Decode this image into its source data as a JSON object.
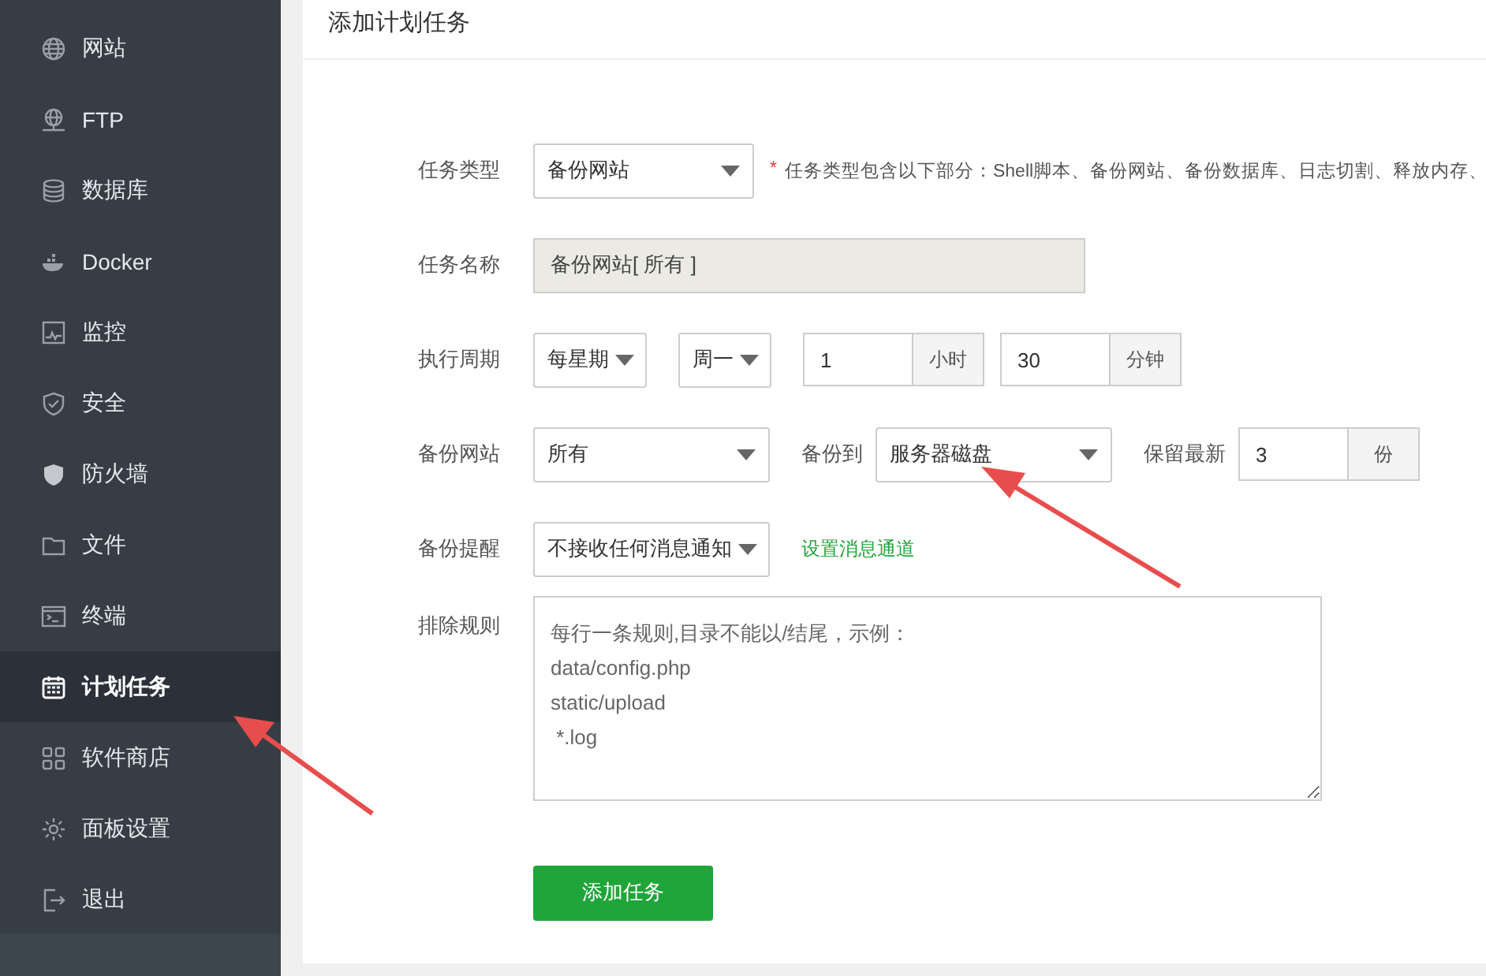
{
  "sidebar": {
    "items": [
      {
        "label": "网站",
        "selected": false
      },
      {
        "label": "FTP",
        "selected": false
      },
      {
        "label": "数据库",
        "selected": false
      },
      {
        "label": "Docker",
        "selected": false
      },
      {
        "label": "监控",
        "selected": false
      },
      {
        "label": "安全",
        "selected": false
      },
      {
        "label": "防火墙",
        "selected": false
      },
      {
        "label": "文件",
        "selected": false
      },
      {
        "label": "终端",
        "selected": false
      },
      {
        "label": "计划任务",
        "selected": true
      },
      {
        "label": "软件商店",
        "selected": false
      },
      {
        "label": "面板设置",
        "selected": false
      },
      {
        "label": "退出",
        "selected": false
      }
    ]
  },
  "panel": {
    "title": "添加计划任务",
    "form": [
      {
        "label": "任务类型",
        "controls": [
          {
            "kind": "select",
            "value": "备份网站"
          },
          {
            "kind": "note",
            "mark": "*",
            "text": "任务类型包含以下部分：Shell脚本、备份网站、备份数据库、日志切割、释放内存、"
          }
        ]
      },
      {
        "label": "任务名称",
        "controls": [
          {
            "kind": "readonly",
            "value": "备份网站[ 所有 ]"
          }
        ]
      },
      {
        "label": "执行周期",
        "controls": [
          {
            "kind": "select",
            "value": "每星期"
          },
          {
            "kind": "select",
            "value": "周一"
          },
          {
            "kind": "unit-input",
            "value": "1",
            "unit": "小时"
          },
          {
            "kind": "unit-input",
            "value": "30",
            "unit": "分钟"
          }
        ]
      },
      {
        "label": "备份网站",
        "controls": [
          {
            "kind": "select",
            "value": "所有"
          },
          {
            "kind": "label",
            "text": "备份到"
          },
          {
            "kind": "select",
            "value": "服务器磁盘"
          },
          {
            "kind": "label",
            "text": "保留最新"
          },
          {
            "kind": "unit-input",
            "value": "3",
            "unit": "份"
          }
        ]
      },
      {
        "label": "备份提醒",
        "controls": [
          {
            "kind": "select",
            "value": "不接收任何消息通知"
          },
          {
            "kind": "link",
            "text": "设置消息通道"
          }
        ]
      },
      {
        "label": "排除规则",
        "controls": [
          {
            "kind": "textarea",
            "placeholder": "每行一条规则,目录不能以/结尾，示例：\ndata/config.php\nstatic/upload\n *.log"
          }
        ]
      }
    ],
    "submit": "添加任务"
  }
}
